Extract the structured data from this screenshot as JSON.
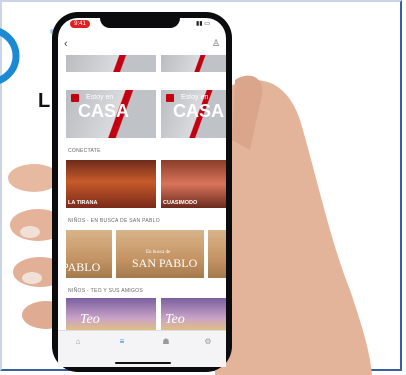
{
  "brand": {
    "logo_letter": "L",
    "registered": "®"
  },
  "status_bar": {
    "time": "9:41"
  },
  "nav": {
    "back_icon": "chevron-left-icon",
    "profile_icon": "user-icon"
  },
  "rows": {
    "top_banner": {
      "tiles": 2
    },
    "estoy_en_casa": {
      "small": "Estoy en",
      "big": "CASA"
    },
    "conectate": {
      "label": "CONECTATE",
      "items": [
        {
          "caption": "LA TIRANA"
        },
        {
          "caption": "CUASIMODO"
        }
      ]
    },
    "ninos": {
      "label": "NIÑOS - EN BUSCA DE SAN PABLO",
      "items": [
        {
          "title": "PABLO"
        },
        {
          "title_small": "En busca de",
          "title": "SAN PABLO"
        }
      ]
    },
    "teo": {
      "label": "NIÑOS - TEO Y SUS AMIGOS",
      "items": [
        {
          "title": "Teo"
        },
        {
          "title": "Teo"
        }
      ]
    }
  },
  "tabbar": {
    "items": [
      {
        "icon": "home-icon",
        "glyph": "⌂"
      },
      {
        "icon": "list-icon",
        "glyph": "≡"
      },
      {
        "icon": "community-icon",
        "glyph": "☗"
      },
      {
        "icon": "settings-icon",
        "glyph": "⚙"
      }
    ]
  },
  "colors": {
    "accent": "#c30010",
    "tab_active": "#1a8ad4",
    "frame": "#3a5fa0"
  }
}
